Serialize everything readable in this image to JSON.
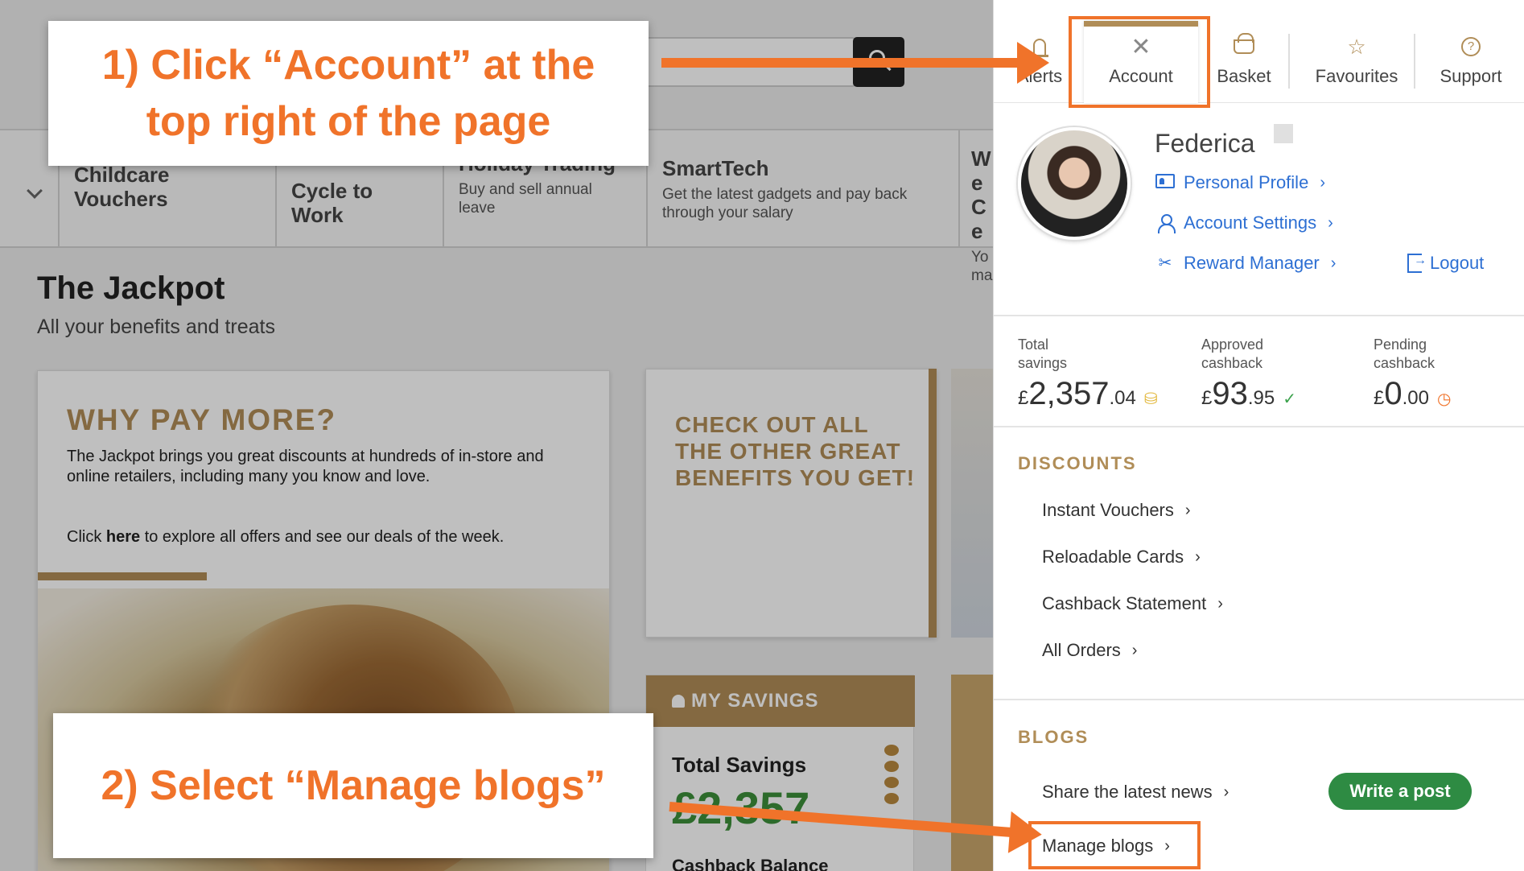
{
  "background": {
    "categories": [
      {
        "title": "Childcare Vouchers",
        "desc": ""
      },
      {
        "title": "Cycle to Work",
        "desc": ""
      },
      {
        "title": "Holiday Trading",
        "desc": "Buy and sell annual leave"
      },
      {
        "title": "SmartTech",
        "desc": "Get the latest gadgets and pay back through your salary"
      },
      {
        "title": "We Ce",
        "desc": "Yo ma"
      }
    ],
    "page_title": "The Jackpot",
    "page_subtitle": "All your benefits and treats",
    "promo_card": {
      "heading": "WHY PAY MORE?",
      "body": "The Jackpot brings you great discounts at hundreds of in-store and online retailers, including many you know and love.",
      "click_prefix": "Click ",
      "click_link": "here",
      "click_suffix": " to explore all offers and see our deals of the week."
    },
    "benefits_card": {
      "heading": "CHECK OUT ALL THE OTHER GREAT BENEFITS YOU GET!"
    },
    "savings_card": {
      "header": "MY SAVINGS",
      "total_label": "Total Savings",
      "total_value": "£2,357",
      "cashback_label": "Cashback Balance"
    }
  },
  "callouts": {
    "step1": "1) Click “Account” at the top right of the page",
    "step2": "2) Select “Manage blogs”"
  },
  "panel": {
    "tabs": [
      {
        "label": "Alerts",
        "icon": "bell-icon"
      },
      {
        "label": "Account",
        "icon": "close-icon"
      },
      {
        "label": "Basket",
        "icon": "basket-icon"
      },
      {
        "label": "Favourites",
        "icon": "star-icon"
      },
      {
        "label": "Support",
        "icon": "help-icon"
      }
    ],
    "profile": {
      "name": "Federica",
      "links": [
        {
          "label": "Personal Profile",
          "icon": "id-card-icon"
        },
        {
          "label": "Account Settings",
          "icon": "user-icon"
        },
        {
          "label": "Reward Manager",
          "icon": "tools-icon"
        }
      ],
      "logout": "Logout"
    },
    "stats": [
      {
        "label": "Total savings",
        "currency": "£",
        "whole": "2,357",
        "decimals": ".04",
        "icon": "coins-icon",
        "icon_color": "#e2b73a"
      },
      {
        "label": "Approved cashback",
        "currency": "£",
        "whole": "93",
        "decimals": ".95",
        "icon": "check-circle-icon",
        "icon_color": "#3aa14b"
      },
      {
        "label": "Pending cashback",
        "currency": "£",
        "whole": "0",
        "decimals": ".00",
        "icon": "clock-icon",
        "icon_color": "#f0732a"
      }
    ],
    "discounts": {
      "title": "DISCOUNTS",
      "items": [
        "Instant Vouchers",
        "Reloadable Cards",
        "Cashback Statement",
        "All Orders"
      ]
    },
    "blogs": {
      "title": "BLOGS",
      "items": [
        "Share the latest news",
        "Manage blogs"
      ],
      "write_button": "Write a post"
    }
  },
  "colors": {
    "accent": "#f0732a",
    "gold": "#b08d57",
    "link": "#2d6fd3",
    "green": "#2e8b43"
  }
}
